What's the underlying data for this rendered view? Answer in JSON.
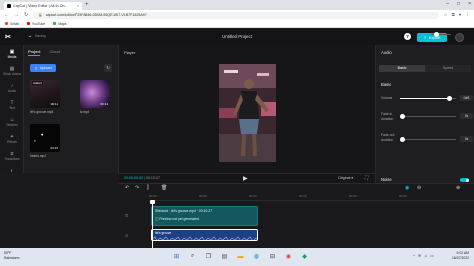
{
  "browser": {
    "tab_title": "CapCut | Video Editor | All-In-On...",
    "url": "capcut.com/editor/F29F8846-0D0M-55QE-8S7-V1B7F1625A9?",
    "bookmarks": [
      "Gmail",
      "YouTube",
      "Maps"
    ]
  },
  "app": {
    "saving": "Saving",
    "project_title": "Untitled Project",
    "export_label": "Export"
  },
  "nav": [
    "Media",
    "Stock videos",
    "Audio",
    "Text",
    "Stickers",
    "Effects",
    "Transitions",
    "Filters"
  ],
  "media": {
    "tabs": [
      "Project",
      "Cloud"
    ],
    "upload_label": "Upload",
    "thumbs": [
      {
        "name": "let's groove.mp4",
        "duration": "00:11",
        "added": "Added"
      },
      {
        "name": "tv.mp4",
        "duration": "00:14",
        "added": ""
      },
      {
        "name": "hearts.mp4",
        "duration": "00:15",
        "added": ""
      }
    ]
  },
  "player": {
    "label": "Player",
    "current_time": "00:00:00:00",
    "total_time": "00:10:27",
    "ratio": "Original"
  },
  "audio_panel": {
    "title": "Audio",
    "tabs": [
      "Basic",
      "Speed"
    ],
    "basic_heading": "Basic",
    "volume_label": "Volume",
    "volume_value": "0dB",
    "volume_level": 0.88,
    "fadein_label": "Fade in duration",
    "fadein_value": "0s",
    "fadein_level": 0.04,
    "fadeout_label": "Fade out duration",
    "fadeout_value": "0s",
    "fadeout_level": 0.04,
    "noise_heading": "Noise"
  },
  "timeline": {
    "ticks": [
      "00:00",
      "00:05",
      "00:10",
      "00:15",
      "00:20",
      "00:25"
    ],
    "clip1_label": "Silenced · let's groove.mp4 · 00:10:27",
    "clip1_warning": "Preview not yet generated",
    "clip2_label": "let's groove"
  },
  "taskbar": {
    "weather_temp": "59°F",
    "weather_desc": "Rainstorm",
    "time": "9:02 AM",
    "date": "16/07/2022"
  }
}
